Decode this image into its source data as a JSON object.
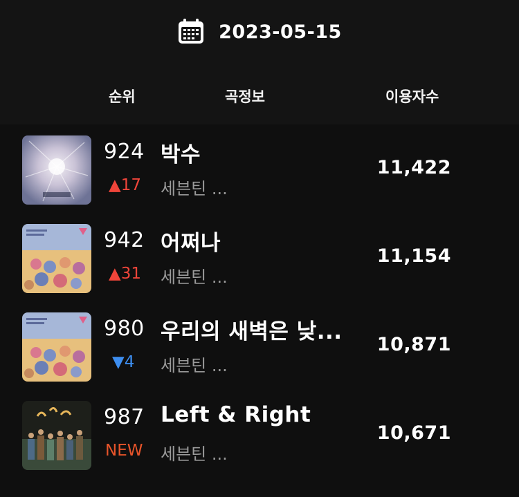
{
  "header": {
    "date": "2023-05-15",
    "calendar_icon": "calendar-icon",
    "columns": {
      "rank": "순위",
      "song": "곡정보",
      "users": "이용자수"
    }
  },
  "rows": [
    {
      "rank": "924",
      "change": "▲17",
      "change_type": "up",
      "title": "박수",
      "artist": "세븐틴 ...",
      "users": "11,422"
    },
    {
      "rank": "942",
      "change": "▲31",
      "change_type": "up",
      "title": "어쩌나",
      "artist": "세븐틴 ...",
      "users": "11,154"
    },
    {
      "rank": "980",
      "change": "▼4",
      "change_type": "down",
      "title": "우리의 새벽은 낮...",
      "artist": "세븐틴 ...",
      "users": "10,871"
    },
    {
      "rank": "987",
      "change": "NEW",
      "change_type": "new",
      "title": "Left & Right",
      "artist": "세븐틴 ...",
      "users": "10,671"
    }
  ],
  "colors": {
    "background": "#0f0f0f",
    "up": "#f0453a",
    "down": "#3d8ef0",
    "new": "#e8542a",
    "artist": "#9a9a9a"
  }
}
